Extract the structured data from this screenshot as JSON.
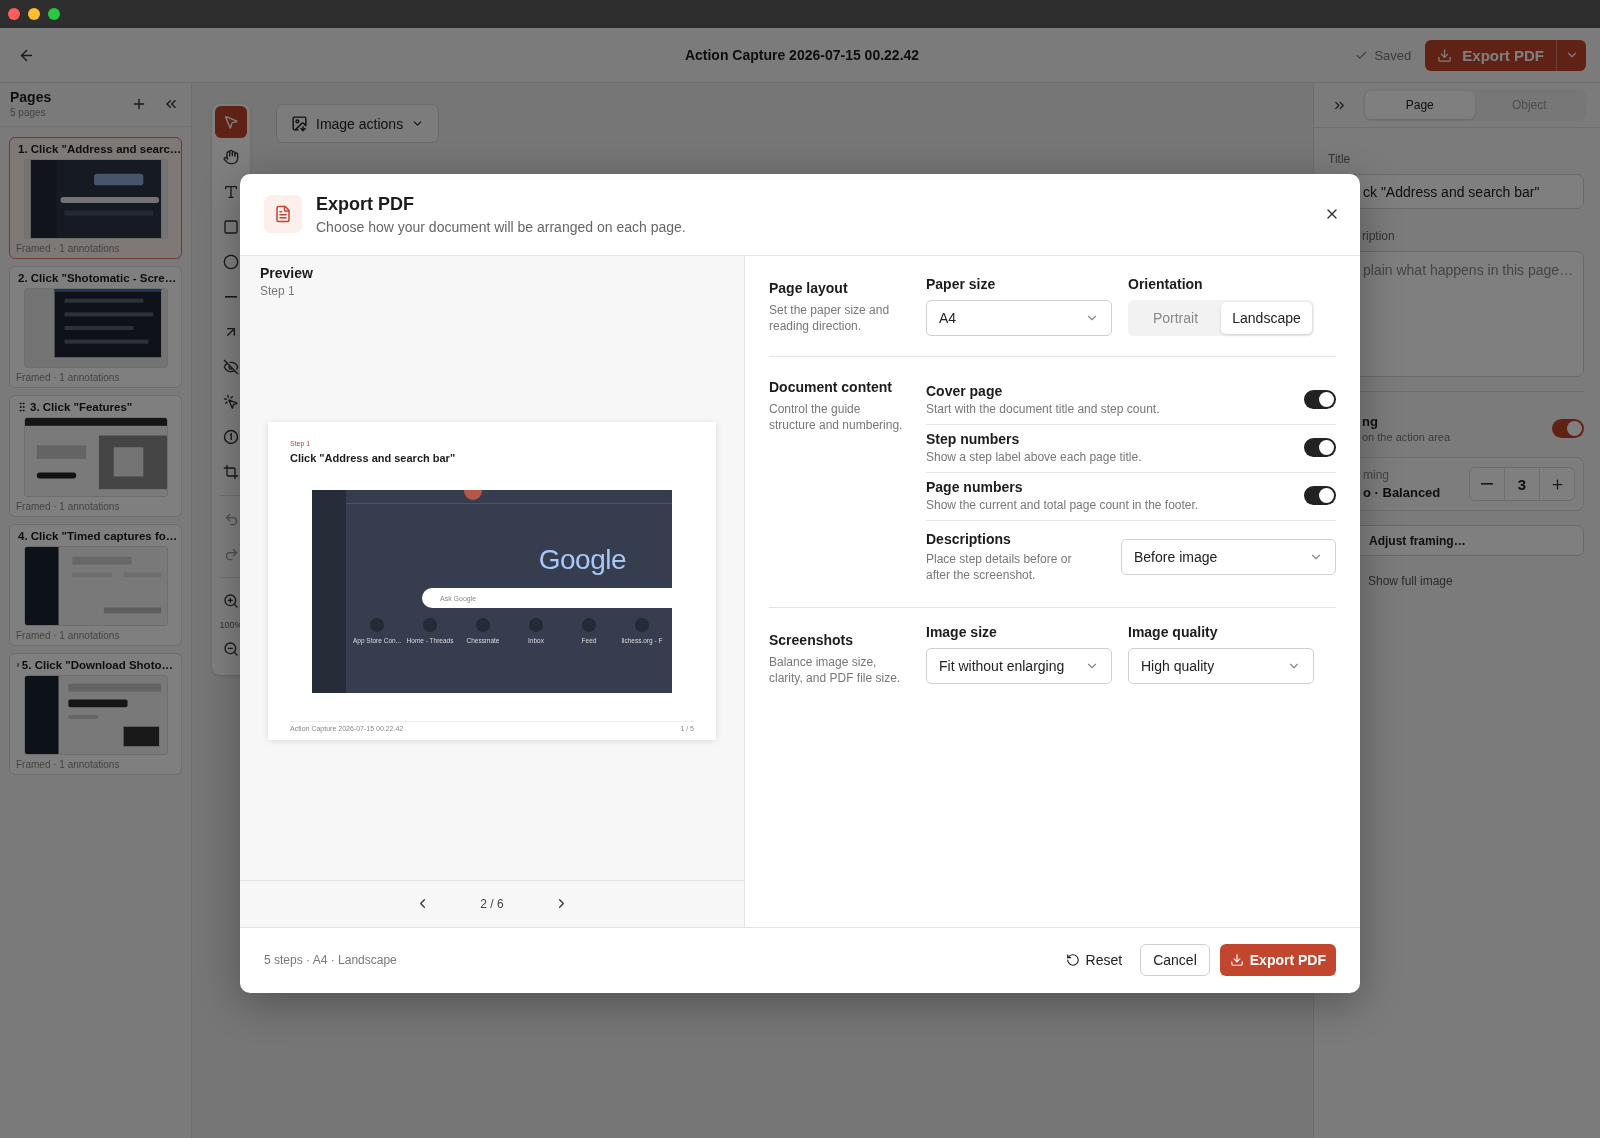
{
  "window": {
    "title": "Action Capture 2026-07-15 00.22.42"
  },
  "header": {
    "saved": "Saved",
    "export_button": "Export PDF"
  },
  "pages_panel": {
    "title": "Pages",
    "count": "5 pages",
    "items": [
      {
        "title": "1. Click \"Address and searc…",
        "meta": "Framed · 1 annotations",
        "selected": true
      },
      {
        "title": "2. Click \"Shotomatic - Scre…",
        "meta": "Framed · 1 annotations",
        "selected": false
      },
      {
        "title": "3. Click \"Features\"",
        "meta": "Framed · 1 annotations",
        "selected": false
      },
      {
        "title": "4. Click \"Timed captures fo…",
        "meta": "Framed · 1 annotations",
        "selected": false
      },
      {
        "title": "5. Click \"Download Shoto…",
        "meta": "Framed · 1 annotations",
        "selected": false
      }
    ]
  },
  "toolbar": {
    "tools": [
      {
        "kind": "pointer",
        "selected": true
      },
      {
        "kind": "hand",
        "selected": false
      },
      {
        "kind": "text",
        "selected": false
      },
      {
        "kind": "rectangle",
        "selected": false
      },
      {
        "kind": "ellipse",
        "selected": false
      },
      {
        "kind": "line",
        "selected": false
      },
      {
        "kind": "arrow",
        "selected": false
      },
      {
        "kind": "hide",
        "selected": false
      },
      {
        "kind": "click",
        "selected": false
      },
      {
        "kind": "step",
        "selected": false
      },
      {
        "kind": "crop",
        "selected": false
      }
    ],
    "zoom": "100%"
  },
  "image_actions": "Image actions",
  "inspector": {
    "tabs": [
      {
        "label": "Page",
        "selected": true
      },
      {
        "label": "Object",
        "selected": false
      }
    ],
    "title_label": "Title",
    "title_value": "ck \"Address and search bar\"",
    "description_label": "ription",
    "description_placeholder": "plain what happens in this page…",
    "highlight": {
      "label": "ng",
      "hint": "on the action area",
      "on": true
    },
    "framing": {
      "label": "ming",
      "value": "o · Balanced",
      "count": "3"
    },
    "adjust_button": "Adjust framing…",
    "show_full_image": "Show full image"
  },
  "dialog": {
    "title": "Export PDF",
    "subtitle": "Choose how your document will be arranged on each page.",
    "preview": {
      "title": "Preview",
      "step": "Step 1",
      "page": {
        "step_label": "Step 1",
        "title": "Click \"Address and search bar\"",
        "logo": "Google",
        "search_placeholder": "Ask Google",
        "shortcuts": [
          "App Store Con...",
          "Home - Threads",
          "Chessmate",
          "Inbox",
          "Feed",
          "lichess.org - F"
        ],
        "footer_left": "Action Capture 2026-07-15 00.22.42",
        "footer_right": "1 / 5"
      },
      "pager": "2 / 6"
    },
    "page_layout": {
      "title": "Page layout",
      "description": "Set the paper size and reading direction.",
      "paper_size": {
        "label": "Paper size",
        "value": "A4"
      },
      "orientation": {
        "label": "Orientation",
        "options": [
          {
            "label": "Portrait",
            "selected": false
          },
          {
            "label": "Landscape",
            "selected": true
          }
        ]
      }
    },
    "document_content": {
      "title": "Document content",
      "description": "Control the guide structure and numbering.",
      "toggles": [
        {
          "label": "Cover page",
          "hint": "Start with the document title and step count.",
          "on": true
        },
        {
          "label": "Step numbers",
          "hint": "Show a step label above each page title.",
          "on": true
        },
        {
          "label": "Page numbers",
          "hint": "Show the current and total page count in the footer.",
          "on": true
        }
      ],
      "descriptions": {
        "label": "Descriptions",
        "hint": "Place step details before or after the screenshot.",
        "value": "Before image"
      }
    },
    "screenshots": {
      "title": "Screenshots",
      "description": "Balance image size, clarity, and PDF file size.",
      "image_size": {
        "label": "Image size",
        "value": "Fit without enlarging"
      },
      "image_quality": {
        "label": "Image quality",
        "value": "High quality"
      }
    },
    "footer": {
      "summary": "5 steps · A4 · Landscape",
      "reset": "Reset",
      "cancel": "Cancel",
      "export": "Export PDF"
    }
  }
}
